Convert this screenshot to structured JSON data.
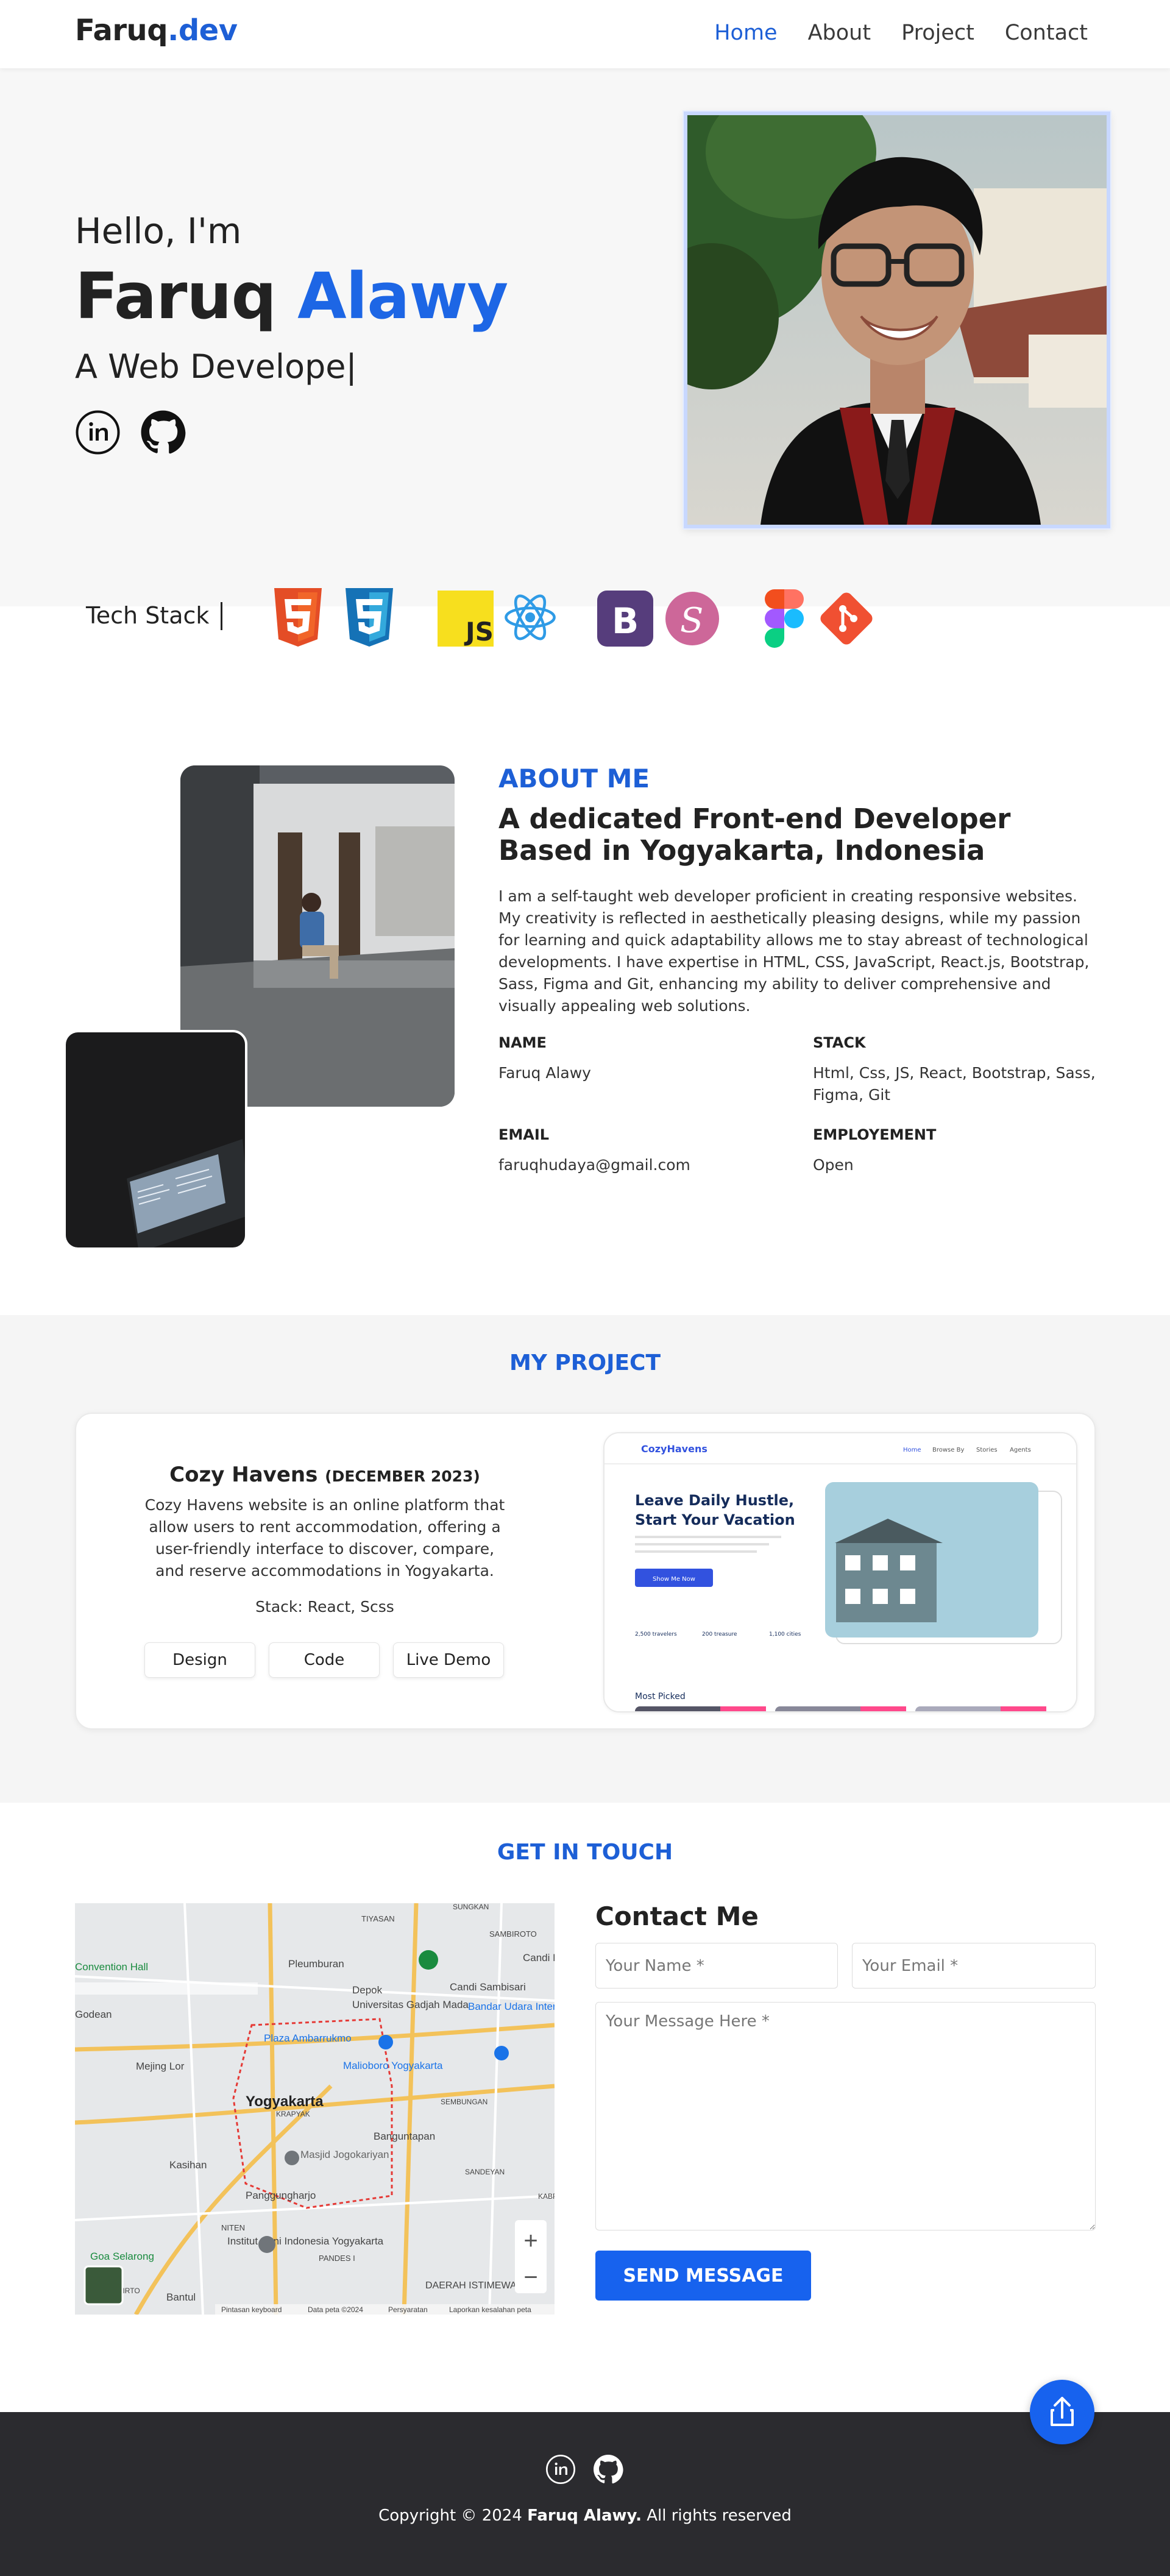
{
  "nav": {
    "logo_main": "Faruq",
    "logo_accent": ".dev",
    "links": [
      "Home",
      "About",
      "Project",
      "Contact"
    ],
    "active": "Home"
  },
  "hero": {
    "greeting": "Hello, I'm",
    "first_name": "Faruq",
    "last_name": "Alawy",
    "role": "A Web Develope|",
    "icons": [
      "linkedin-icon",
      "github-icon"
    ]
  },
  "tech_stack": {
    "label": "Tech Stack",
    "icons": [
      "html5-icon",
      "css3-icon",
      "javascript-icon",
      "react-icon",
      "bootstrap-icon",
      "sass-icon",
      "figma-icon",
      "git-icon"
    ]
  },
  "about": {
    "kicker": "ABOUT ME",
    "title": "A dedicated Front-end Developer Based in Yogyakarta, Indonesia",
    "text": "I am a self-taught web developer proficient in creating responsive websites. My creativity is reflected in aesthetically pleasing designs, while my passion for learning and quick adaptability allows me to stay abreast of technological developments. I have expertise in HTML, CSS, JavaScript, React.js, Bootstrap, Sass, Figma and Git, enhancing my ability to deliver comprehensive and visually appealing web solutions.",
    "info": {
      "name_label": "NAME",
      "name_value": "Faruq Alawy",
      "stack_label": "STACK",
      "stack_value": "Html, Css, JS, React, Bootstrap, Sass, Figma, Git",
      "email_label": "EMAIL",
      "email_value": "faruqhudaya@gmail.com",
      "employment_label": "EMPLOYEMENT",
      "employment_value": "Open"
    }
  },
  "projects": {
    "heading": "MY PROJECT",
    "items": [
      {
        "name": "Cozy Havens",
        "date": "(DECEMBER 2023)",
        "description": "Cozy Havens website is an online platform that allow users to rent accommodation, offering a user-friendly interface to discover, compare, and reserve accommodations in Yogyakarta.",
        "stack": "Stack: React, Scss",
        "buttons": [
          "Design",
          "Code",
          "Live Demo"
        ],
        "preview": {
          "logo": "CozyHavens",
          "menu": [
            "Home",
            "Browse By",
            "Stories",
            "Agents"
          ],
          "headline_1": "Leave Daily Hustle,",
          "headline_2": "Start Your Vacation",
          "cta": "Show Me Now",
          "stats": [
            "2,500 travelers",
            "200 treasure",
            "1,100 cities"
          ],
          "section": "Most Picked"
        }
      }
    ]
  },
  "contact": {
    "heading": "GET IN TOUCH",
    "title": "Contact Me",
    "name_placeholder": "Your Name *",
    "email_placeholder": "Your Email *",
    "message_placeholder": "Your Message Here *",
    "send_label": "SEND MESSAGE",
    "map": {
      "labels": [
        "TIYASAN",
        "SAMBIROTO",
        "Convention Hall",
        "Pleumburan",
        "Candi P",
        "Depok",
        "Candi Sambisari",
        "Godean",
        "Universitas Gadjah Mada",
        "Bandar Udara Internasional Adisutjipto",
        "Plaza Ambarrukmo",
        "Malioboro Yogyakarta",
        "Mejing Lor",
        "Yogyakarta",
        "Banguntapan",
        "Kasihan",
        "Masjid Jogokariyan",
        "Panggungharjo",
        "SANDEYAN",
        "NITEN",
        "Institut Seni Indonesia Yogyakarta",
        "PANDES I",
        "Goa Selarong",
        "Bantul",
        "DAERAH ISTIMEWA",
        "SUNGKAN",
        "TAMANTIRTO",
        "KRAPYAK",
        "SEMBUNGAN",
        "KABR"
      ],
      "footer": [
        "Pintasan keyboard",
        "Data peta ©2024",
        "Persyaratan",
        "Laporkan kesalahan peta"
      ],
      "zoom_in": "+",
      "zoom_out": "−"
    }
  },
  "footer": {
    "icons": [
      "linkedin-icon",
      "github-icon"
    ],
    "copyright_prefix": "Copyright © 2024 ",
    "copyright_name": "Faruq Alawy.",
    "copyright_suffix": " All rights reserved"
  }
}
